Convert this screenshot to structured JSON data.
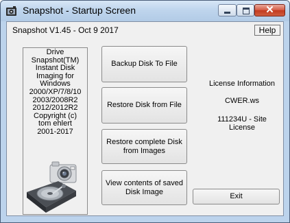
{
  "window": {
    "title": "Snapshot - Startup Screen",
    "icon": "snapshot-app-icon",
    "caption_buttons": {
      "minimize": "minimize",
      "maximize": "maximize",
      "close": "✕"
    }
  },
  "header": {
    "version": "Snapshot V1.45 - Oct  9 2017",
    "help_label": "Help"
  },
  "info_panel": {
    "text": "Drive\nSnapshot(TM)\nInstant Disk\nImaging for\nWindows\n2000/XP/7/8/10\n2003/2008R2\n2012/2012R2\nCopyright (c)\ntom ehlert\n2001-2017",
    "images": [
      "camera-image",
      "hard-disk-image"
    ]
  },
  "actions": [
    {
      "label": "Backup Disk To File"
    },
    {
      "label": "Restore Disk from File"
    },
    {
      "label": "Restore complete Disk\nfrom Images"
    },
    {
      "label": "View contents of saved\nDisk Image"
    }
  ],
  "license": {
    "title": "License Information",
    "licensee": "CWER.ws",
    "key": "111234U - Site License"
  },
  "exit_label": "Exit",
  "colors": {
    "titlebar": "#bfd5ed",
    "close_button": "#c8452a",
    "client_background": "#f0f0f0"
  }
}
